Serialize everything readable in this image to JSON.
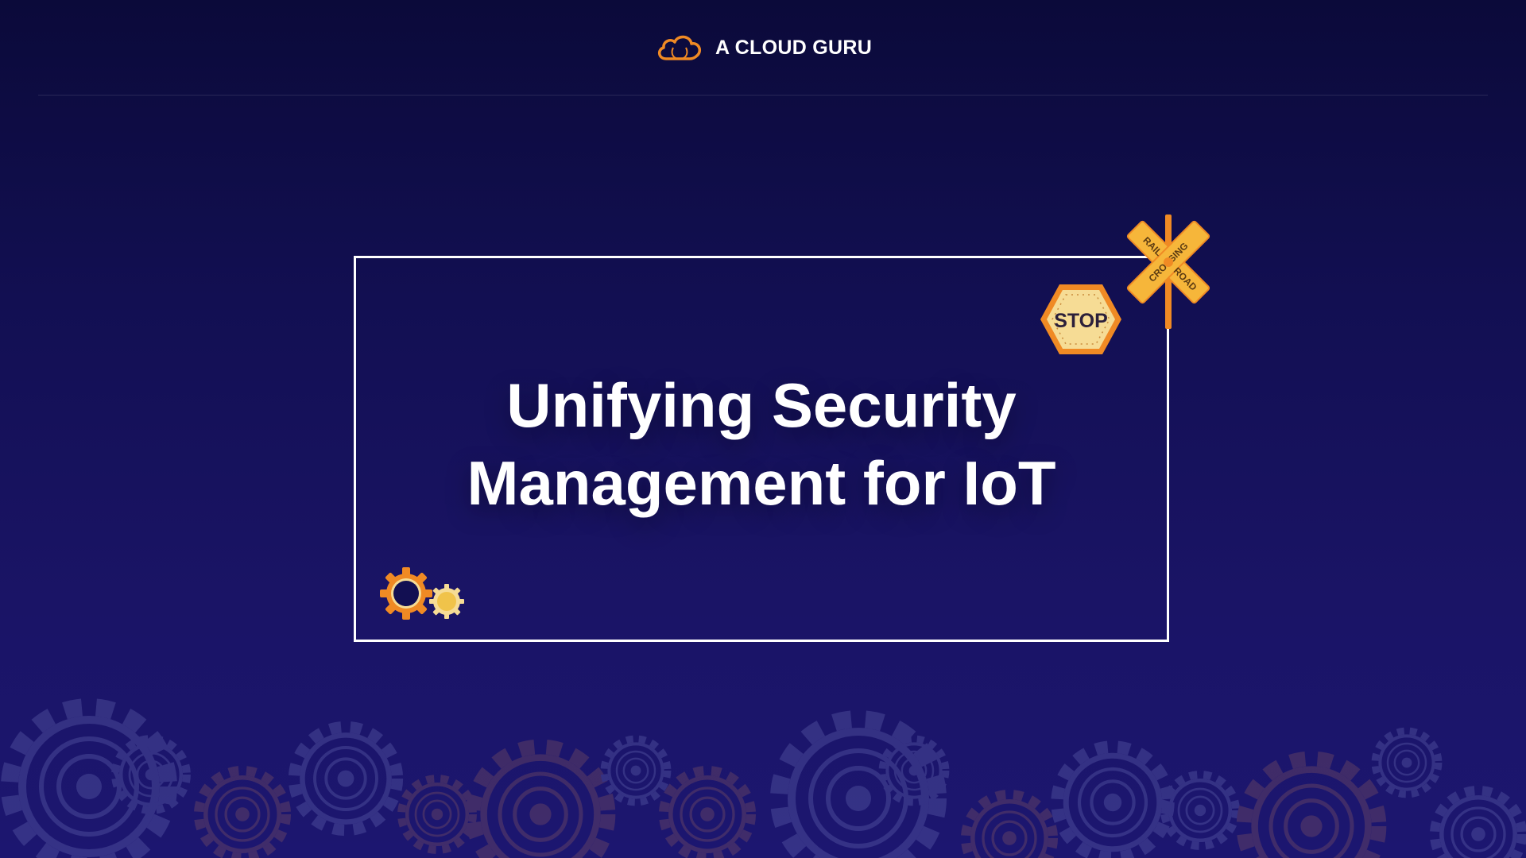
{
  "brand": {
    "name": "A CLOUD GURU",
    "icon": "cloud-logo-icon",
    "accent": "#f08a24"
  },
  "slide": {
    "title_lines": [
      "Unifying Security",
      "Management for IoT"
    ]
  },
  "decor": {
    "stop_sign_text": "STOP",
    "railroad_sign_text": [
      "RAIL",
      "CROSSING",
      "ROAD"
    ]
  },
  "colors": {
    "background": "#150f5c",
    "frame": "#ffffff",
    "orange": "#f08a24",
    "cream": "#f6dc95"
  }
}
